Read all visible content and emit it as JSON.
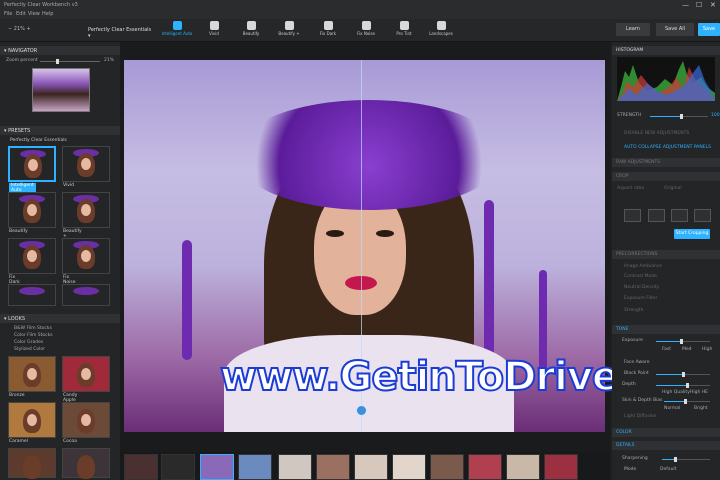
{
  "window": {
    "title": "Perfectly Clear Workbench v3",
    "controls": [
      "—",
      "☐",
      "✕"
    ]
  },
  "menu": [
    "File",
    "Edit",
    "View",
    "Help"
  ],
  "toolbar": {
    "zoom": "21%",
    "preset_select": "Perfectly Clear Essentials",
    "tools": [
      {
        "label": "Intelligent Auto",
        "icon": "wand-icon",
        "active": true
      },
      {
        "label": "Vivid",
        "icon": "brush-icon",
        "active": false
      },
      {
        "label": "Beautify",
        "icon": "face-icon",
        "active": false
      },
      {
        "label": "Beautify +",
        "icon": "face-plus-icon",
        "active": false
      },
      {
        "label": "Fix Dark",
        "icon": "sun-icon",
        "active": false
      },
      {
        "label": "Fix Noise",
        "icon": "noise-icon",
        "active": false
      },
      {
        "label": "Pro Tint",
        "icon": "tint-icon",
        "active": false
      },
      {
        "label": "Landscapes",
        "icon": "landscape-icon",
        "active": false
      }
    ],
    "learn": "Learn",
    "save_all": "Save All",
    "save": "Save"
  },
  "left": {
    "navigator": {
      "title": "NAVIGATOR",
      "zoom_label": "Zoom percent",
      "zoom_value": "21%"
    },
    "presets": {
      "title": "PRESETS",
      "group": "Perfectly Clear Essentials",
      "items": [
        {
          "label": "Intelligent Auto",
          "selected": true
        },
        {
          "label": "Vivid",
          "selected": false
        },
        {
          "label": "Beautify",
          "selected": false
        },
        {
          "label": "Beautify +",
          "selected": false
        },
        {
          "label": "Fix Dark",
          "selected": false
        },
        {
          "label": "Fix Noise",
          "selected": false
        }
      ]
    },
    "looks": {
      "title": "LOOKS",
      "groups": [
        "B&W Film Stocks",
        "Color Film Stocks",
        "Color Grades",
        "Stylized Color"
      ],
      "items": [
        "Bronze",
        "Candy Apple",
        "Caramel",
        "Cocoa"
      ]
    }
  },
  "canvas": {
    "watermark": "www.GetinToDrive.com"
  },
  "right": {
    "histogram_title": "HISTOGRAM",
    "strength_label": "STRENGTH",
    "strength_value": "100",
    "disable_all": "DISABLE NEW ADJUSTMENTS",
    "auto_collapse": "AUTO COLLAPSE ADJUSTMENT PANELS",
    "raw": "RAW ADJUSTMENTS",
    "crop": {
      "title": "CROP",
      "aspect_label": "Aspect ratio",
      "aspect_value": "Original",
      "start_cropping": "Start Cropping"
    },
    "pre": {
      "title": "PRECORRECTIONS",
      "rows": [
        "Image Ambiance",
        "Contrast Mode",
        "Neutral Density",
        "Exposure Filter",
        "Strength"
      ]
    },
    "tone": {
      "title": "TONE",
      "rows": [
        "Exposure",
        "Face Aware",
        "Black Point",
        "Depth",
        "Skin & Depth Bias",
        "Light Diffusion"
      ],
      "exposure_modes": [
        "Fast",
        "Med",
        "High"
      ],
      "depth_modes": [
        "High Quality",
        "High HE"
      ],
      "bias_modes": [
        "Normal",
        "Bright"
      ]
    },
    "color": {
      "title": "COLOR"
    },
    "details": {
      "title": "DETAILS",
      "rows": [
        "Sharpening",
        "Mode"
      ],
      "mode_value": "Default"
    }
  },
  "colors": {
    "accent": "#2fb2ff",
    "panel": "#242527",
    "header": "#303134",
    "canvas": "#1a1b1d"
  }
}
